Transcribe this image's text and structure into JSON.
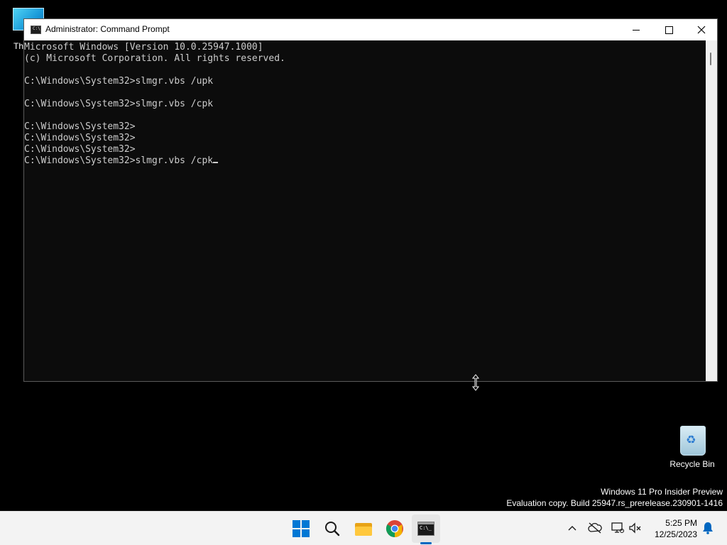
{
  "desktop": {
    "icons": {
      "this_pc_label": "Th",
      "recycle_bin_label": "Recycle Bin"
    },
    "watermark": {
      "line1": "Windows 11 Pro Insider Preview",
      "line2": "Evaluation copy. Build 25947.rs_prerelease.230901-1416"
    }
  },
  "window": {
    "title": "Administrator: Command Prompt",
    "console_lines": [
      "Microsoft Windows [Version 10.0.25947.1000]",
      "(c) Microsoft Corporation. All rights reserved.",
      "",
      "C:\\Windows\\System32>slmgr.vbs /upk",
      "",
      "C:\\Windows\\System32>slmgr.vbs /cpk",
      "",
      "C:\\Windows\\System32>",
      "C:\\Windows\\System32>",
      "C:\\Windows\\System32>",
      "C:\\Windows\\System32>slmgr.vbs /cpk"
    ]
  },
  "taskbar": {
    "apps": [
      "start-button",
      "search-button",
      "file-explorer",
      "chrome",
      "command-prompt"
    ],
    "active_app": "command-prompt",
    "clock": {
      "time": "5:25 PM",
      "date": "12/25/2023"
    }
  },
  "colors": {
    "console_bg": "#0c0c0c",
    "console_fg": "#cccccc",
    "accent": "#0067c0"
  }
}
